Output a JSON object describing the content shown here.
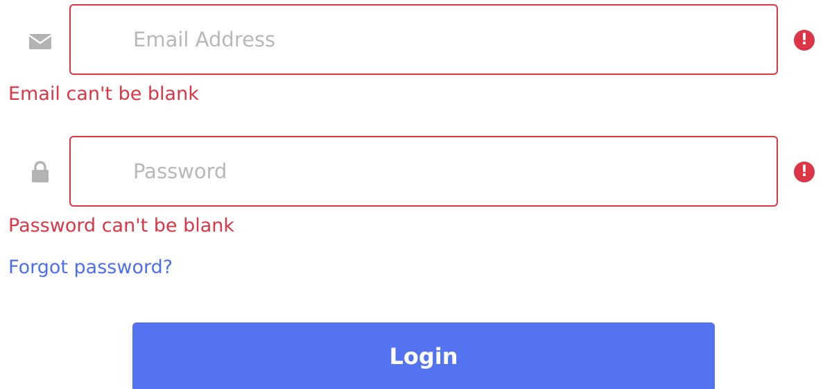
{
  "email": {
    "placeholder": "Email Address",
    "value": "",
    "error": "Email can't be blank",
    "icon": "envelope-icon"
  },
  "password": {
    "placeholder": "Password",
    "value": "",
    "error": "Password can't be blank",
    "icon": "lock-icon"
  },
  "error_icon": {
    "glyph": "!",
    "icon": "exclamation-circle-icon"
  },
  "forgot_password": {
    "label": "Forgot password?"
  },
  "login_button": {
    "label": "Login"
  },
  "colors": {
    "error": "#dc3545",
    "link": "#4d6ef0",
    "primary": "#5473f0",
    "icon_gray": "#b3b3b3",
    "placeholder": "#b8b8b8"
  }
}
